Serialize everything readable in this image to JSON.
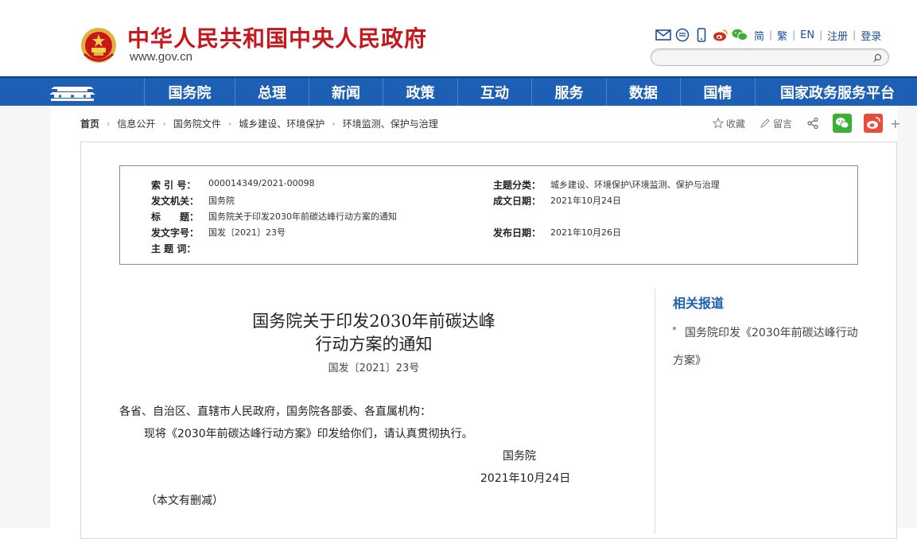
{
  "header": {
    "site_title": "中华人民共和国中央人民政府",
    "site_url": "www.gov.cn",
    "tools": [
      "mail-icon",
      "message-icon",
      "mobile-icon",
      "weibo-icon",
      "wechat-icon"
    ],
    "languages": [
      "简",
      "繁",
      "EN"
    ],
    "register": "注册",
    "login": "登录",
    "search_placeholder": ""
  },
  "nav": {
    "items": [
      "国务院",
      "总理",
      "新闻",
      "政策",
      "互动",
      "服务",
      "数据",
      "国情",
      "国家政务服务平台"
    ]
  },
  "breadcrumb": [
    "首页",
    "信息公开",
    "国务院文件",
    "城乡建设、环境保护",
    "环境监测、保护与治理"
  ],
  "share": {
    "favorite": "收藏",
    "comment": "留言"
  },
  "info": {
    "index_label": "索 引 号：",
    "index_value": "000014349/2021-00098",
    "category_label": "主题分类：",
    "category_value": "城乡建设、环境保护\\环境监测、保护与治理",
    "issuer_label": "发文机关：",
    "issuer_value": "国务院",
    "created_label": "成文日期：",
    "created_value": "2021年10月24日",
    "title_label": "标　　题：",
    "title_value": "国务院关于印发2030年前碳达峰行动方案的通知",
    "docno_label": "发文字号：",
    "docno_value": "国发〔2021〕23号",
    "published_label": "发布日期：",
    "published_value": "2021年10月26日",
    "keywords_label": "主 题 词：",
    "keywords_value": ""
  },
  "article": {
    "title_line1": "国务院关于印发2030年前碳达峰",
    "title_line2": "行动方案的通知",
    "doc_number": "国发〔2021〕23号",
    "recipients": "各省、自治区、直辖市人民政府，国务院各部委、各直属机构：",
    "body": "现将《2030年前碳达峰行动方案》印发给你们，请认真贯彻执行。",
    "signature": "国务院",
    "date": "2021年10月24日",
    "note": "（本文有删减）"
  },
  "related": {
    "title": "相关报道",
    "items": [
      "国务院印发《2030年前碳达峰行动方案》"
    ]
  },
  "colors": {
    "brand_red": "#c8161d",
    "nav_blue": "#1c5fb5",
    "link_blue": "#1a4f9a"
  }
}
